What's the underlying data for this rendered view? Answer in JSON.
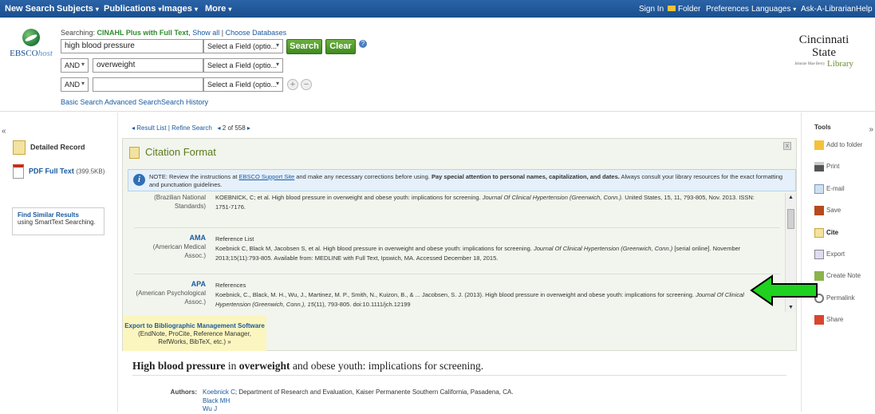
{
  "topnav": {
    "new_search": "New Search",
    "subjects": "Subjects",
    "publications": "Publications",
    "images": "Images",
    "more": "More",
    "sign_in": "Sign In",
    "folder": "Folder",
    "preferences": "Preferences",
    "languages": "Languages",
    "ask": "Ask-A-Librarian",
    "help": "Help",
    "caret": "▾"
  },
  "logo": {
    "ebsco": "EBSCO",
    "host": "host"
  },
  "search": {
    "searching_label": "Searching:",
    "database": "CINAHL Plus with Full Text",
    "show_all": "Show all",
    "choose_db": "Choose Databases",
    "row1_value": "high blood pressure",
    "row2_value": "overweight",
    "row3_value": "",
    "field_select": "Select a Field (optio...",
    "bool": "AND",
    "search_btn": "Search",
    "clear_btn": "Clear",
    "help_q": "?",
    "plus": "+",
    "minus": "−",
    "basic": "Basic Search",
    "advanced": "Advanced Search",
    "history": "Search History"
  },
  "library": {
    "name": "Cincinnati State",
    "sub": "Johnnie Mae Berry",
    "lib": "Library"
  },
  "left": {
    "collapse": "«",
    "detailed": "Detailed Record",
    "pdf": "PDF Full Text",
    "pdf_size": "(399.5KB)",
    "similar_title": "Find Similar Results",
    "similar_sub": "using SmartText Searching."
  },
  "pager": {
    "result_list": "Result List",
    "refine": "Refine Search",
    "position": "2 of 558"
  },
  "citation": {
    "title": "Citation Format",
    "close": "x",
    "note_pre": "NOTE: Review the instructions at ",
    "note_link": "EBSCO Support Site",
    "note_mid": " and make any necessary corrections before using. ",
    "note_bold": "Pay special attention to personal names, capitalization, and dates.",
    "note_post": " Always consult your library resources for the exact formatting and punctuation guidelines.",
    "entries": [
      {
        "name": "",
        "desc": "(Brazilian National Standards)",
        "heading": "",
        "text": "KOEBNICK, C; et al. High blood pressure in overweight and obese youth: implications for screening.",
        "journal": "Journal Of Clinical Hypertension (Greenwich, Conn.).",
        "tail": "United States, 15, 11, 793-805, Nov. 2013. ISSN: 1751-7176."
      },
      {
        "name": "AMA",
        "desc": "(American Medical Assoc.)",
        "heading": "Reference List",
        "text": "Koebnick C, Black M, Jacobsen S, et al. High blood pressure in overweight and obese youth: implications for screening.",
        "journal": "Journal Of Clinical Hypertension (Greenwich, Conn.)",
        "tail": "[serial online]. November 2013;15(11):793-805. Available from: MEDLINE with Full Text, Ipswich, MA. Accessed December 18, 2015."
      },
      {
        "name": "APA",
        "desc": "(American Psychological Assoc.)",
        "heading": "References",
        "text": "Koebnick, C., Black, M. H., Wu, J., Martinez, M. P., Smith, N., Kuizon, B., & ... Jacobsen, S. J. (2013). High blood pressure in overweight and obese youth: implications for screening.",
        "journal": "Journal Of Clinical Hypertension (Greenwich, Conn.), 15",
        "tail": "(11), 793-805. doi:10.1111/jch.12199"
      }
    ],
    "export_link": "Export to Bibliographic Management Software",
    "export_tail": "(EndNote, ProCite, Reference Manager, RefWorks, BibTeX, etc.) »"
  },
  "article": {
    "t1": "High blood pressure",
    "t2": " in ",
    "t3": "overweight",
    "t4": " and obese youth: implications for screening.",
    "authors_label": "Authors:",
    "author1": "Koebnick C",
    "author1_aff": "; Department of Research and Evaluation, Kaiser Permanente Southern California, Pasadena, CA.",
    "author2": "Black MH",
    "author3": "Wu J"
  },
  "tools": {
    "heading": "Tools",
    "collapse": "»",
    "add_folder": "Add to folder",
    "print": "Print",
    "email": "E-mail",
    "save": "Save",
    "cite": "Cite",
    "export": "Export",
    "create_note": "Create Note",
    "permalink": "Permalink",
    "share": "Share"
  },
  "colors": {
    "nav": "#1a4f8e",
    "accent_green": "#4a9a2a",
    "arrow": "#1fd21f"
  }
}
